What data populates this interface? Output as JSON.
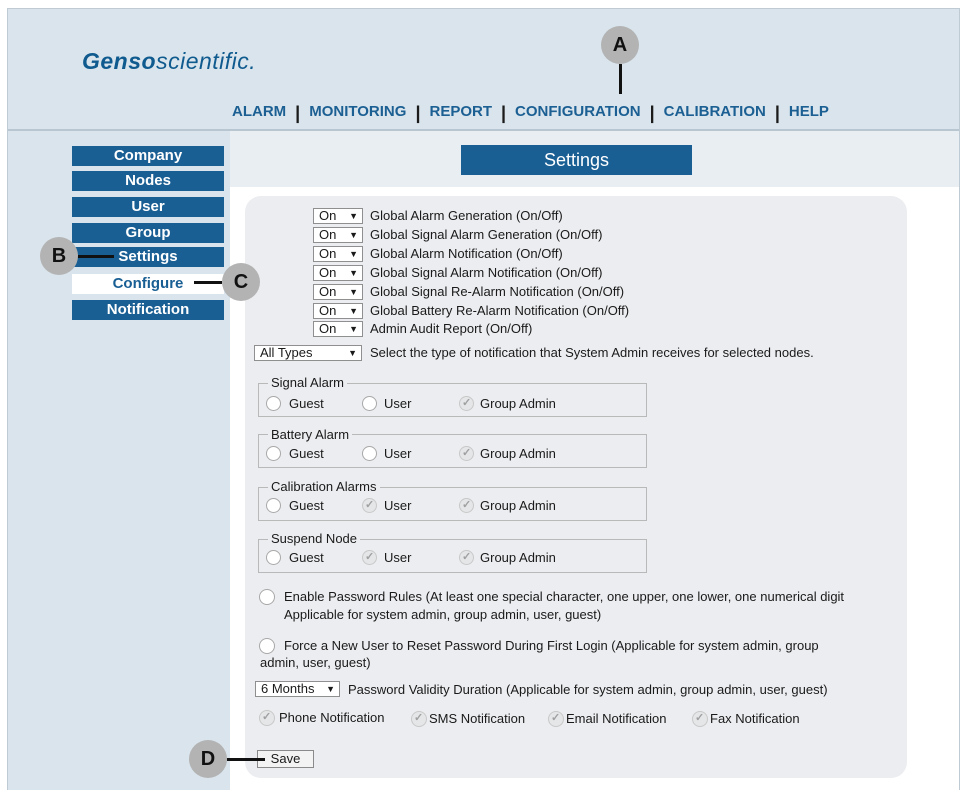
{
  "header": {
    "logo": {
      "g": "G",
      "bold": "enso",
      "light": "scientific."
    },
    "nav": [
      "ALARM",
      "MONITORING",
      "REPORT",
      "CONFIGURATION",
      "CALIBRATION",
      "HELP"
    ],
    "separator": "|"
  },
  "sidebar": {
    "items": [
      {
        "label": "Company",
        "active": false
      },
      {
        "label": "Nodes",
        "active": false
      },
      {
        "label": "User",
        "active": false
      },
      {
        "label": "Group",
        "active": false
      },
      {
        "label": "Settings",
        "active": false
      },
      {
        "label": "Configure",
        "active": true
      },
      {
        "label": "Notification",
        "active": false
      }
    ]
  },
  "main": {
    "title": "Settings",
    "toggles": [
      {
        "value": "On",
        "label": "Global Alarm Generation (On/Off)"
      },
      {
        "value": "On",
        "label": "Global Signal Alarm Generation (On/Off)"
      },
      {
        "value": "On",
        "label": "Global Alarm Notification (On/Off)"
      },
      {
        "value": "On",
        "label": "Global Signal Alarm Notification (On/Off)"
      },
      {
        "value": "On",
        "label": "Global Signal Re-Alarm Notification (On/Off)"
      },
      {
        "value": "On",
        "label": "Global Battery Re-Alarm Notification (On/Off)"
      },
      {
        "value": "On",
        "label": "Admin Audit Report (On/Off)"
      }
    ],
    "notification_type": {
      "value": "All Types",
      "label": "Select the type of notification that System Admin receives for selected nodes."
    },
    "groups": [
      {
        "legend": "Signal Alarm",
        "options": [
          {
            "label": "Guest",
            "checked": false
          },
          {
            "label": "User",
            "checked": false
          },
          {
            "label": "Group Admin",
            "checked": true
          }
        ]
      },
      {
        "legend": "Battery Alarm",
        "options": [
          {
            "label": "Guest",
            "checked": false
          },
          {
            "label": "User",
            "checked": false
          },
          {
            "label": "Group Admin",
            "checked": true
          }
        ]
      },
      {
        "legend": "Calibration Alarms",
        "options": [
          {
            "label": "Guest",
            "checked": false
          },
          {
            "label": "User",
            "checked": true
          },
          {
            "label": "Group Admin",
            "checked": true
          }
        ]
      },
      {
        "legend": "Suspend Node",
        "options": [
          {
            "label": "Guest",
            "checked": false
          },
          {
            "label": "User",
            "checked": true
          },
          {
            "label": "Group Admin",
            "checked": true
          }
        ]
      }
    ],
    "password_rules": {
      "line1": "Enable Password Rules (At least one special character, one upper, one lower, one numerical digit",
      "line2": "Applicable for system admin, group admin, user, guest)",
      "checked": false
    },
    "force_reset": {
      "line1": "Force a New User to Reset Password During First Login (Applicable for system admin, group",
      "line2": "admin, user, guest)",
      "checked": false
    },
    "password_validity": {
      "value": "6 Months",
      "label": "Password Validity Duration (Applicable for system admin, group admin, user, guest)"
    },
    "notifications": [
      {
        "label": "Phone Notification",
        "checked": true
      },
      {
        "label": "SMS Notification",
        "checked": true
      },
      {
        "label": "Email Notification",
        "checked": true
      },
      {
        "label": "Fax Notification",
        "checked": true
      }
    ],
    "save_label": "Save"
  },
  "callouts": [
    "A",
    "B",
    "C",
    "D"
  ],
  "colors": {
    "brand_blue": "#1a5f94",
    "background": "#d9e4ec",
    "panel": "#ecedf0"
  }
}
